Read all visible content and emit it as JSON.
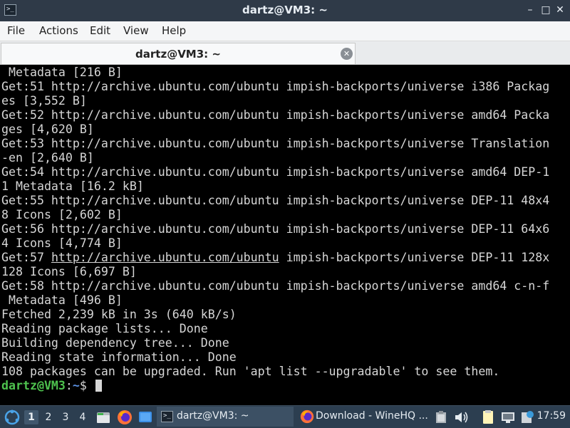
{
  "window": {
    "title": "dartz@VM3: ~",
    "minimize": "–",
    "maximize": "□",
    "close": "✕"
  },
  "menu": [
    "File",
    "Actions",
    "Edit",
    "View",
    "Help"
  ],
  "tab": {
    "label": "dartz@VM3: ~"
  },
  "terminal": {
    "lines": [
      " Metadata [216 B]",
      "Get:51 http://archive.ubuntu.com/ubuntu impish-backports/universe i386 Packag",
      "es [3,552 B]",
      "Get:52 http://archive.ubuntu.com/ubuntu impish-backports/universe amd64 Packa",
      "ges [4,620 B]",
      "Get:53 http://archive.ubuntu.com/ubuntu impish-backports/universe Translation",
      "-en [2,640 B]",
      "Get:54 http://archive.ubuntu.com/ubuntu impish-backports/universe amd64 DEP-1",
      "1 Metadata [16.2 kB]",
      "Get:55 http://archive.ubuntu.com/ubuntu impish-backports/universe DEP-11 48x4",
      "8 Icons [2,602 B]",
      "Get:56 http://archive.ubuntu.com/ubuntu impish-backports/universe DEP-11 64x6",
      "4 Icons [4,774 B]",
      "Get:57 ",
      "128 Icons [6,697 B]",
      "Get:58 http://archive.ubuntu.com/ubuntu impish-backports/universe amd64 c-n-f",
      " Metadata [496 B]",
      "Fetched 2,239 kB in 3s (640 kB/s)",
      "Reading package lists... Done",
      "Building dependency tree... Done",
      "Reading state information... Done",
      "108 packages can be upgraded. Run 'apt list --upgradable' to see them."
    ],
    "link_line_url": "http://archive.ubuntu.com/ubuntu",
    "link_line_rest": " impish-backports/universe DEP-11 128x",
    "prompt_user": "dartz@VM3",
    "prompt_sep": ":",
    "prompt_path": "~",
    "prompt_symbol": "$ "
  },
  "panel": {
    "workspaces": [
      "1",
      "2",
      "3",
      "4"
    ],
    "tasks": [
      {
        "label": "dartz@VM3: ~",
        "icon": "terminal-icon"
      },
      {
        "label": "Download - WineHQ ...",
        "icon": "firefox-icon"
      }
    ],
    "clock": "17:59"
  },
  "colors": {
    "prompt_user": "#4ec24e",
    "prompt_path": "#5a8fe0",
    "panel": "#2c3e50"
  }
}
